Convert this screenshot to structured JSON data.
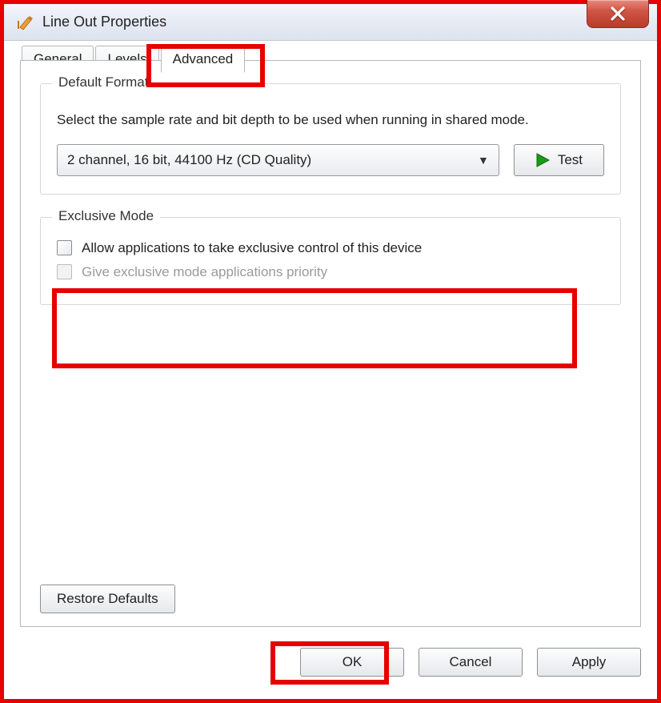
{
  "window": {
    "title": "Line Out Properties"
  },
  "tabs": [
    {
      "id": "general",
      "label": "General",
      "active": false
    },
    {
      "id": "levels",
      "label": "Levels",
      "active": false
    },
    {
      "id": "advanced",
      "label": "Advanced",
      "active": true
    }
  ],
  "default_format": {
    "legend": "Default Format",
    "description": "Select the sample rate and bit depth to be used when running in shared mode.",
    "selected": "2 channel, 16 bit, 44100 Hz (CD Quality)",
    "test_button": "Test"
  },
  "exclusive_mode": {
    "legend": "Exclusive Mode",
    "options": [
      {
        "id": "allow-exclusive",
        "label": "Allow applications to take exclusive control of this device",
        "checked": false,
        "enabled": true
      },
      {
        "id": "exclusive-priority",
        "label": "Give exclusive mode applications priority",
        "checked": false,
        "enabled": false
      }
    ]
  },
  "restore_defaults": "Restore Defaults",
  "buttons": {
    "ok": "OK",
    "cancel": "Cancel",
    "apply": "Apply"
  },
  "highlights": [
    "tab-advanced",
    "exclusive-mode-options",
    "ok-button"
  ]
}
